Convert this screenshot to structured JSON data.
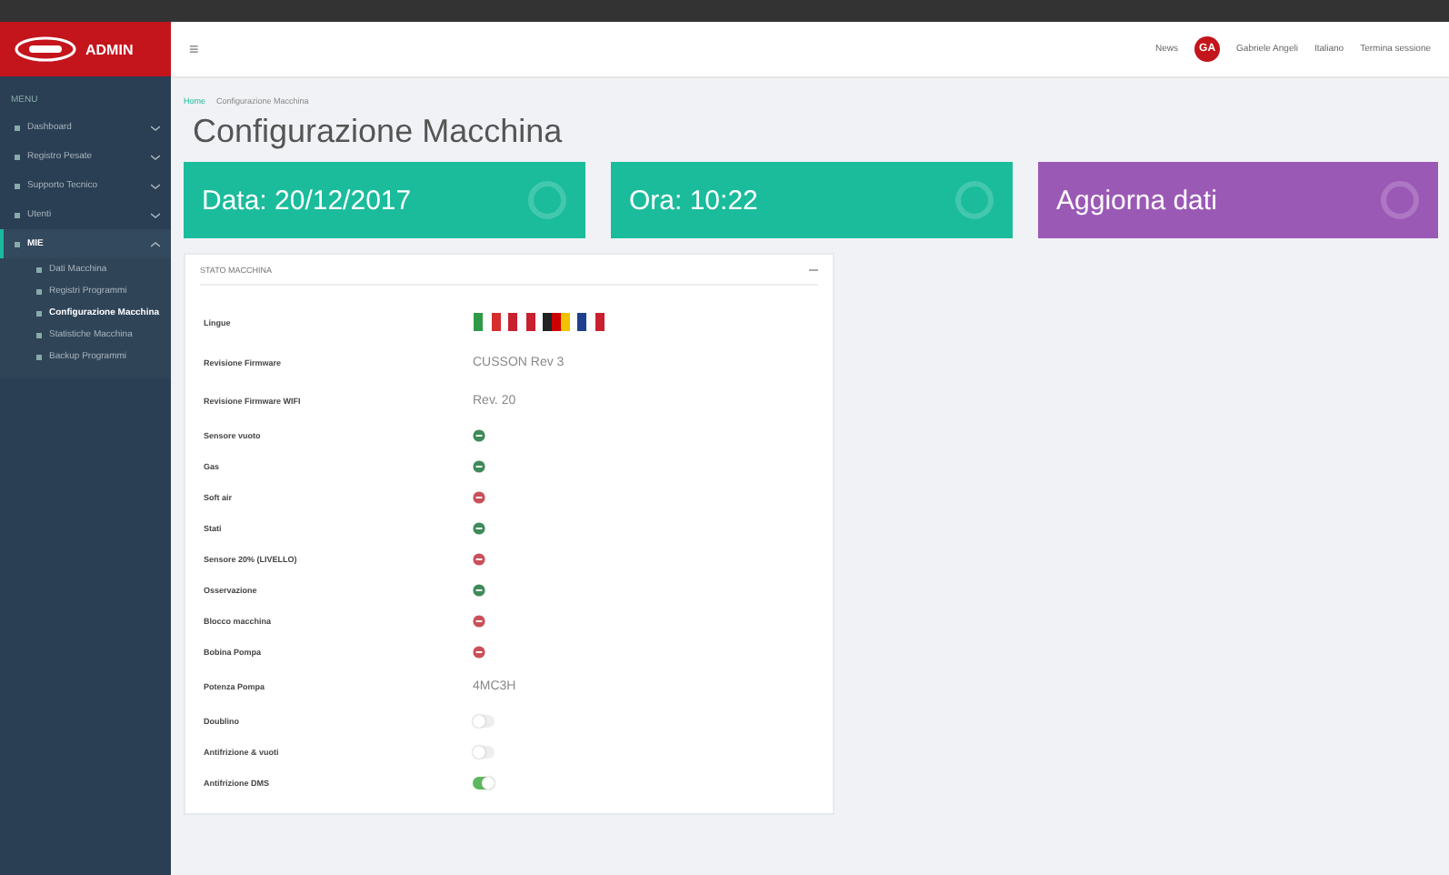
{
  "brand": {
    "name": "ADMIN"
  },
  "sidebar": {
    "heading": "MENU",
    "items": [
      {
        "label": "Dashboard",
        "expanded": false
      },
      {
        "label": "Registro Pesate",
        "expanded": false
      },
      {
        "label": "Supporto Tecnico",
        "expanded": false
      },
      {
        "label": "Utenti",
        "expanded": false
      },
      {
        "label": "MIE",
        "expanded": true,
        "children": [
          {
            "label": "Dati Macchina",
            "selected": false
          },
          {
            "label": "Registri Programmi",
            "selected": false
          },
          {
            "label": "Configurazione Macchina",
            "selected": true
          },
          {
            "label": "Statistiche Macchina",
            "selected": false
          },
          {
            "label": "Backup Programmi",
            "selected": false
          }
        ]
      }
    ]
  },
  "topbar": {
    "menu_glyph": "≡",
    "news": "News",
    "avatar": "GA",
    "user": "Gabriele Angeli",
    "language": "Italiano",
    "logout": "Termina sessione"
  },
  "breadcrumb": [
    "Home",
    "Configurazione Macchina"
  ],
  "title": "Configurazione Macchina",
  "cards": [
    {
      "text": "Data: 20/12/2017",
      "color": "#1abc9c"
    },
    {
      "text": "Ora: 10:22",
      "color": "#1abc9c"
    },
    {
      "text": "Aggiorna dati",
      "color": "#9b59b6"
    }
  ],
  "panel": {
    "title": "STATO MACCHINA",
    "rows": [
      {
        "kind": "flags",
        "label": "Lingue"
      },
      {
        "kind": "text",
        "label": "Revisione Firmware",
        "value": "CUSSON Rev 3"
      },
      {
        "kind": "text",
        "label": "Revisione Firmware WIFI",
        "value": "Rev. 20"
      },
      {
        "kind": "status",
        "label": "Sensore vuoto",
        "ok": true
      },
      {
        "kind": "status",
        "label": "Gas",
        "ok": true
      },
      {
        "kind": "status",
        "label": "Soft air",
        "ok": false
      },
      {
        "kind": "status",
        "label": "Stati",
        "ok": true
      },
      {
        "kind": "status",
        "label": "Sensore 20% (LIVELLO)",
        "ok": false
      },
      {
        "kind": "status",
        "label": "Osservazione",
        "ok": true
      },
      {
        "kind": "status",
        "label": "Blocco macchina",
        "ok": false
      },
      {
        "kind": "status",
        "label": "Bobina Pompa",
        "ok": false
      },
      {
        "kind": "text",
        "label": "Potenza Pompa",
        "value": "4MC3H"
      },
      {
        "kind": "toggle",
        "label": "Doublino",
        "on": false
      },
      {
        "kind": "toggle",
        "label": "Antifrizione & vuoti",
        "on": false
      },
      {
        "kind": "toggle",
        "label": "Antifrizione DMS",
        "on": true
      }
    ]
  }
}
